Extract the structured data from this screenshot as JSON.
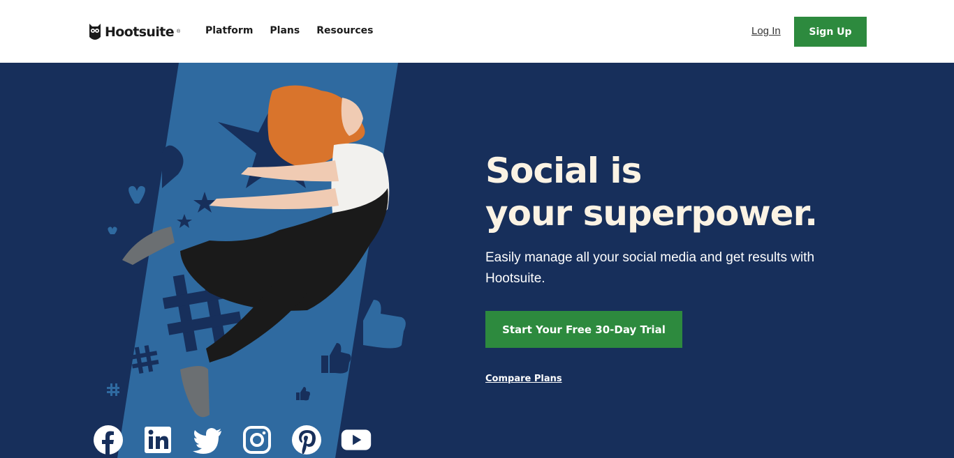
{
  "header": {
    "logo_text": "Hootsuite",
    "logo_mark": "®",
    "nav": [
      {
        "label": "Platform"
      },
      {
        "label": "Plans"
      },
      {
        "label": "Resources"
      }
    ],
    "login_label": "Log In",
    "signup_label": "Sign Up"
  },
  "hero": {
    "headline_line1": "Social is",
    "headline_line2": "your superpower.",
    "subtitle": "Easily manage all your social media and get results with Hootsuite.",
    "cta_label": "Start Your Free 30-Day Trial",
    "compare_label": "Compare Plans",
    "social_icons": [
      "facebook-icon",
      "linkedin-icon",
      "twitter-icon",
      "instagram-icon",
      "pinterest-icon",
      "youtube-icon"
    ]
  },
  "colors": {
    "brand_green": "#2d8a3e",
    "hero_navy": "#172f5b",
    "hero_cream": "#fbf3e4",
    "band_blue": "#2f6aa0"
  }
}
